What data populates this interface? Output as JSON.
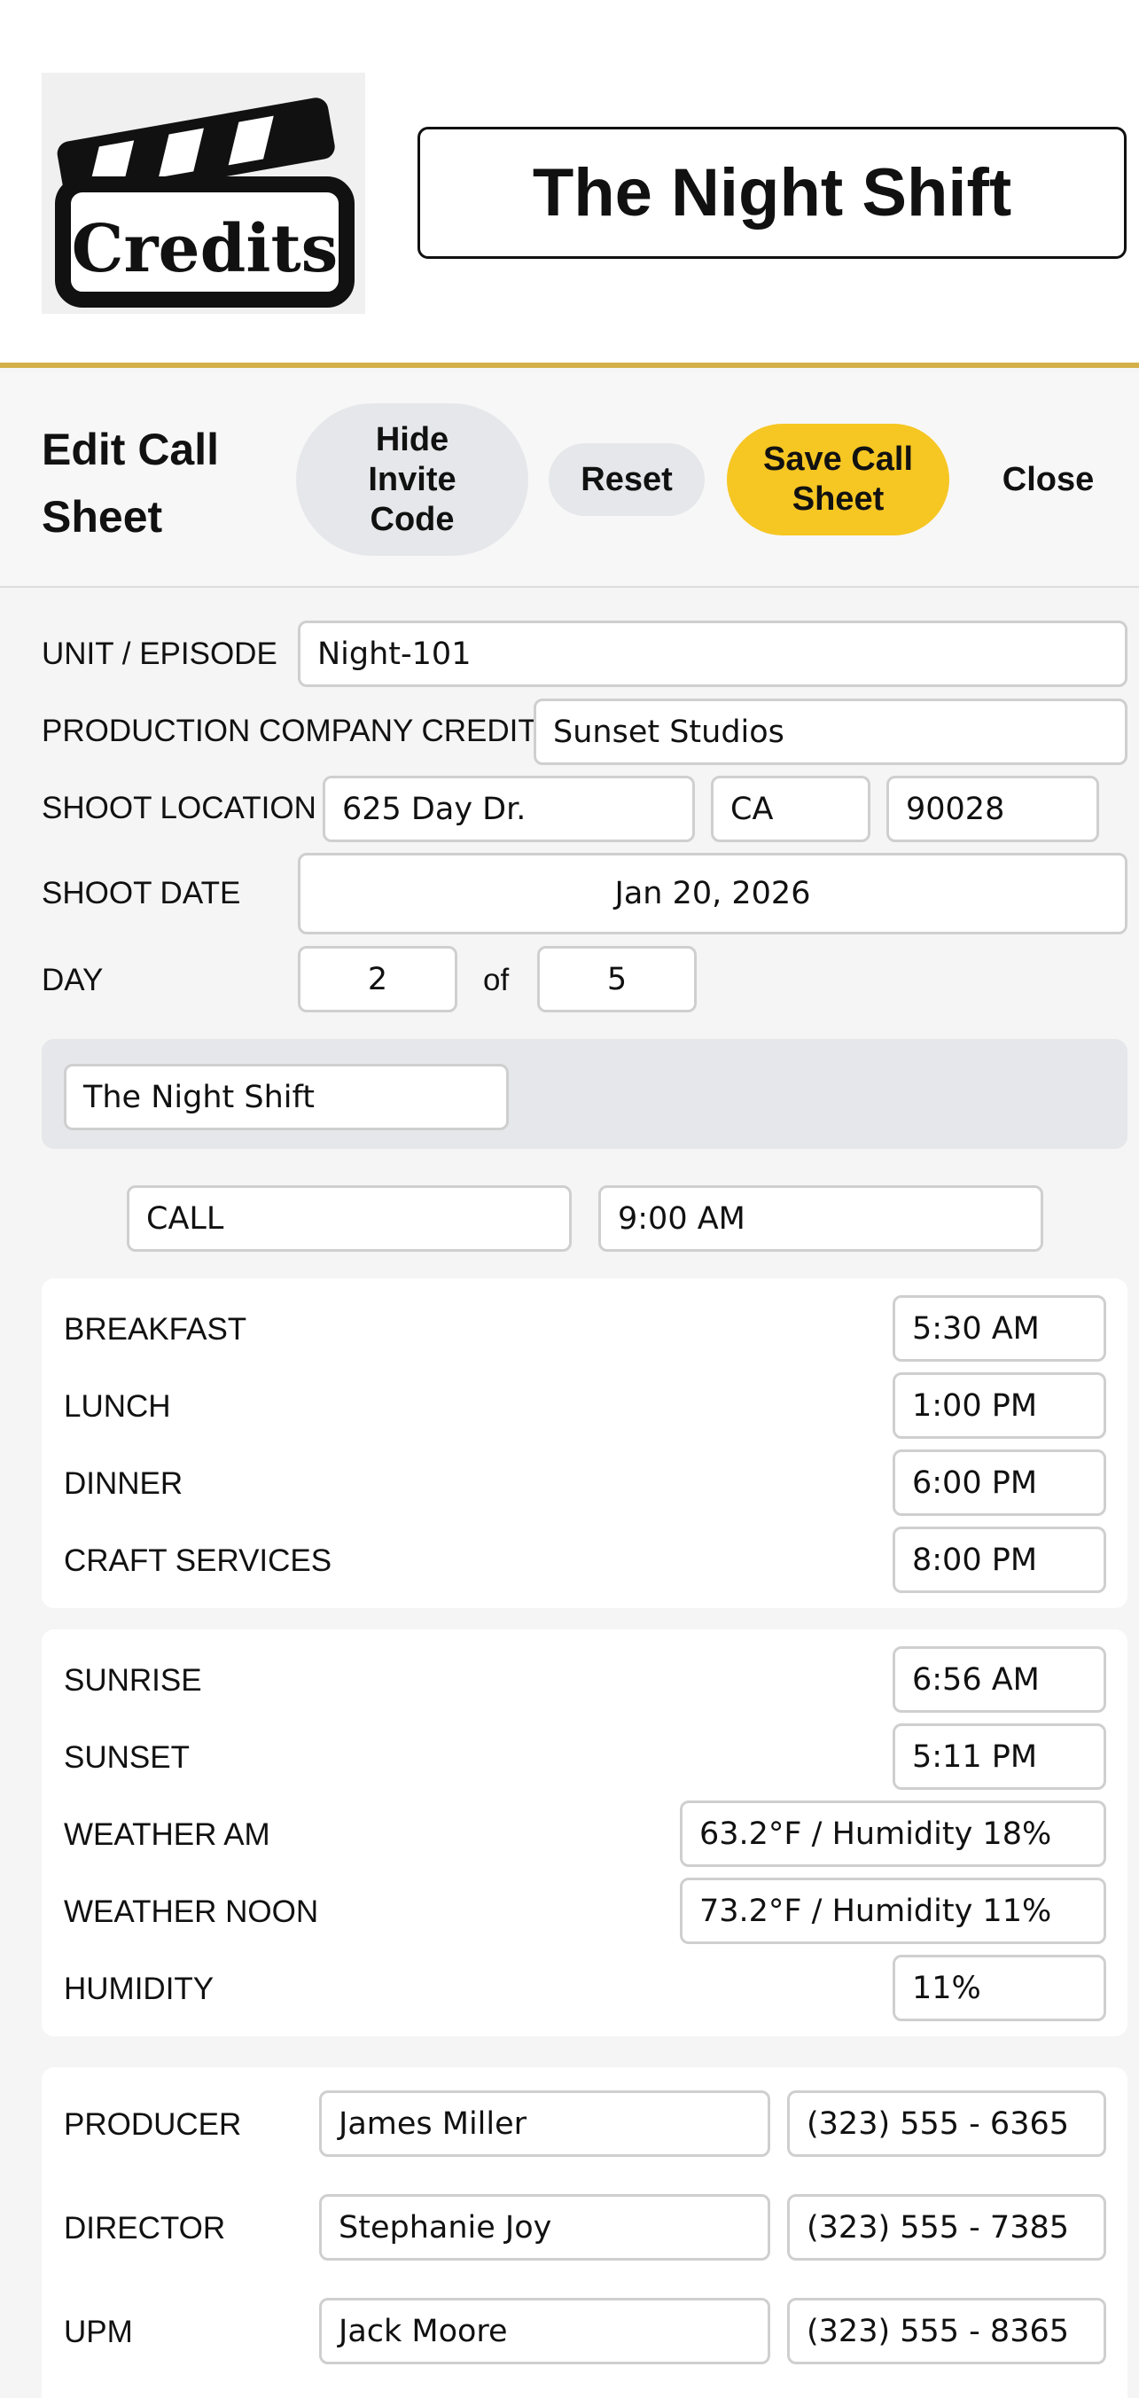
{
  "header": {
    "logo_text": "Credits",
    "production_title": "The Night Shift"
  },
  "toolbar": {
    "title": "Edit Call Sheet",
    "hide_invite_label": "Hide Invite Code",
    "reset_label": "Reset",
    "save_label": "Save Call Sheet",
    "close_label": "Close"
  },
  "form": {
    "unit_label": "UNIT / EPISODE",
    "unit_value": "Night-101",
    "company_label": "PRODUCTION COMPANY CREDIT",
    "company_value": "Sunset Studios",
    "location_label": "SHOOT LOCATION",
    "location_address": "625 Day Dr.",
    "location_state": "CA",
    "location_zip": "90028",
    "date_label": "SHOOT DATE",
    "date_value": "Jan 20, 2026",
    "day_label": "DAY",
    "day_value": "2",
    "of_text": "of",
    "day_total": "5",
    "title_value": "The Night Shift",
    "call_label_value": "CALL",
    "call_time_value": "9:00 AM"
  },
  "meals": [
    {
      "label": "BREAKFAST",
      "value": "5:30 AM"
    },
    {
      "label": "LUNCH",
      "value": "1:00 PM"
    },
    {
      "label": "DINNER",
      "value": "6:00 PM"
    },
    {
      "label": "CRAFT SERVICES",
      "value": "8:00 PM"
    }
  ],
  "conditions": [
    {
      "label": "SUNRISE",
      "value": "6:56 AM"
    },
    {
      "label": "SUNSET",
      "value": "5:11 PM"
    },
    {
      "label": "WEATHER AM",
      "value": "63.2°F / Humidity 18%"
    },
    {
      "label": "WEATHER NOON",
      "value": "73.2°F / Humidity 11%"
    },
    {
      "label": "HUMIDITY",
      "value": "11%"
    }
  ],
  "contacts": [
    {
      "role": "PRODUCER",
      "name": "James Miller",
      "phone": "(323) 555 - 6365"
    },
    {
      "role": "DIRECTOR",
      "name": "Stephanie Joy",
      "phone": "(323) 555 - 7385"
    },
    {
      "role": "UPM",
      "name": "Jack Moore",
      "phone": "(323) 555 - 8365"
    }
  ],
  "colors": {
    "accent_gold": "#d4b04a",
    "save_button": "#f6c623",
    "neutral_button": "#e6e7ea"
  }
}
